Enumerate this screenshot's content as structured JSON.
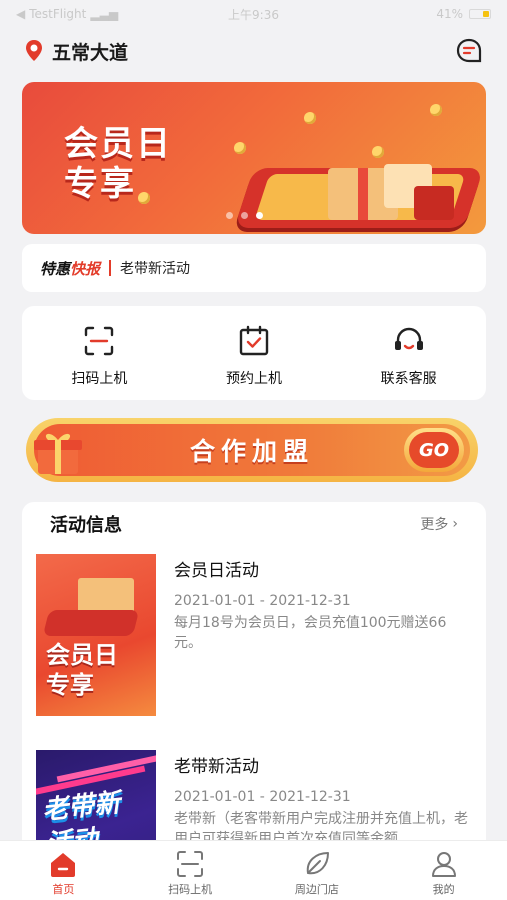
{
  "status_bar": {
    "carrier": "TestFlight",
    "time": "上午9:36",
    "battery": "41%"
  },
  "header": {
    "city": "五常大道"
  },
  "banner": {
    "slogan_line1": "会员日",
    "slogan_line2": "专享"
  },
  "news": {
    "tag_prefix": "特惠",
    "tag_suffix": "快报",
    "text": "老带新活动"
  },
  "quick_actions": [
    {
      "label": "扫码上机",
      "icon": "scan-icon"
    },
    {
      "label": "预约上机",
      "icon": "calendar-check-icon"
    },
    {
      "label": "联系客服",
      "icon": "headset-icon"
    }
  ],
  "join_banner": {
    "text": "合作加盟",
    "go": "GO"
  },
  "activity": {
    "title": "活动信息",
    "more": "更多",
    "items": [
      {
        "name": "会员日活动",
        "date": "2021-01-01 - 2021-12-31",
        "desc": "每月18号为会员日，会员充值100元赠送66元。",
        "thumb_line1": "会员日",
        "thumb_line2": "专享"
      },
      {
        "name": "老带新活动",
        "date": "2021-01-01 - 2021-12-31",
        "desc": "老带新（老客带新用户完成注册并充值上机，老用户可获得新用户首次充值同等金额",
        "thumb_line1": "老带新",
        "thumb_line2": "活动"
      }
    ]
  },
  "tabbar": [
    {
      "label": "首页",
      "icon": "home-icon",
      "active": true
    },
    {
      "label": "扫码上机",
      "icon": "scan-icon",
      "active": false
    },
    {
      "label": "周边门店",
      "icon": "leaf-icon",
      "active": false
    },
    {
      "label": "我的",
      "icon": "user-icon",
      "active": false
    }
  ],
  "colors": {
    "accent": "#e23b2b",
    "banner": "#f26b3b",
    "gold": "#f5b443"
  }
}
